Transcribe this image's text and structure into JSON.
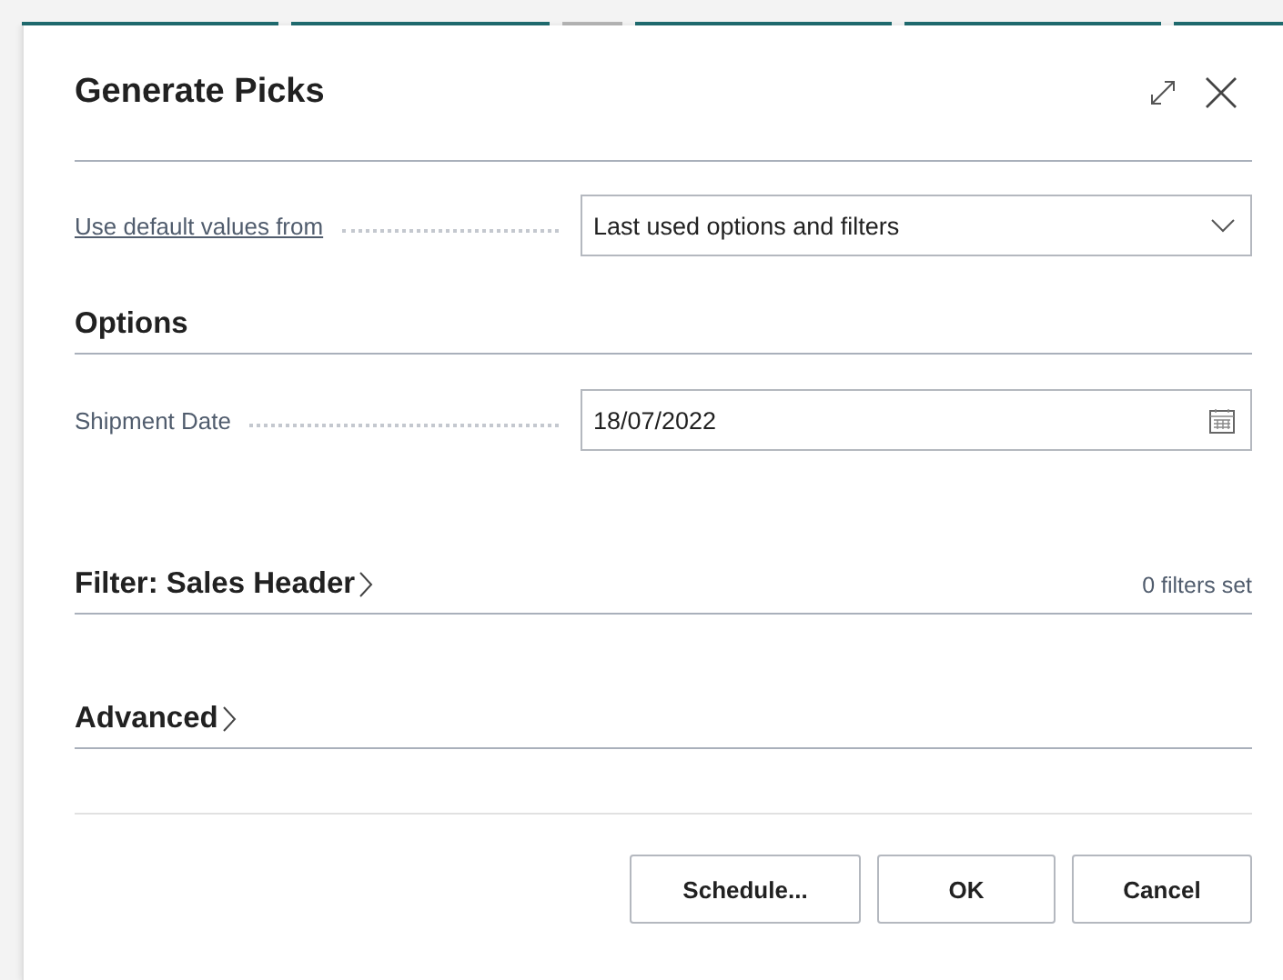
{
  "dialog": {
    "title": "Generate Picks"
  },
  "defaults": {
    "label": "Use default values from",
    "value": "Last used options and filters"
  },
  "options": {
    "heading": "Options",
    "fields": [
      {
        "label": "Shipment Date",
        "value": "18/07/2022"
      }
    ]
  },
  "sections": [
    {
      "title": "Filter: Sales Header",
      "summary": "0 filters set"
    },
    {
      "title": "Advanced"
    }
  ],
  "buttons": [
    "Schedule...",
    "OK",
    "Cancel"
  ]
}
